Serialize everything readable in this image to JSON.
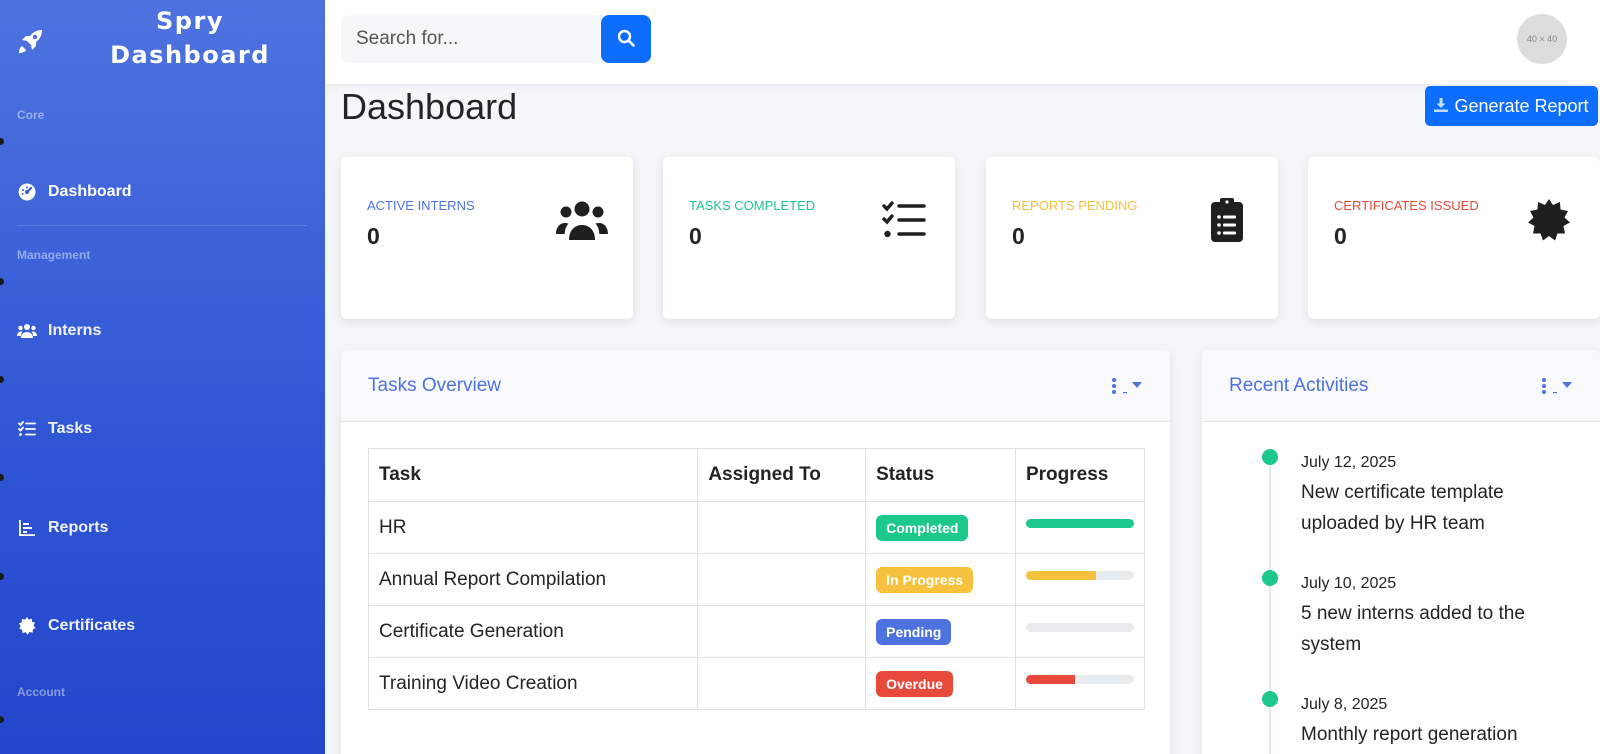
{
  "brand": {
    "line1": "Spry",
    "line2": "Dashboard"
  },
  "sidebar": {
    "sections": {
      "core": "Core",
      "management": "Management",
      "account": "Account"
    },
    "items": [
      {
        "label": "Dashboard",
        "icon": "tachometer-icon",
        "active": true
      },
      {
        "label": "Interns",
        "icon": "users-icon"
      },
      {
        "label": "Tasks",
        "icon": "tasks-icon"
      },
      {
        "label": "Reports",
        "icon": "chart-bar-icon"
      },
      {
        "label": "Certificates",
        "icon": "certificate-icon"
      }
    ]
  },
  "topbar": {
    "search_placeholder": "Search for...",
    "avatar_text": "40 × 40"
  },
  "page": {
    "title": "Dashboard",
    "generate_label": "Generate Report"
  },
  "stats": [
    {
      "label": "Active Interns",
      "value": "0",
      "color": "#4e73df",
      "icon": "users-icon"
    },
    {
      "label": "Tasks Completed",
      "value": "0",
      "color": "#1cc88a",
      "icon": "tasks-icon"
    },
    {
      "label": "Reports Pending",
      "value": "0",
      "color": "#f6c23e",
      "icon": "clipboard-list-icon"
    },
    {
      "label": "Certificates Issued",
      "value": "0",
      "color": "#e74a3b",
      "icon": "certificate-icon"
    }
  ],
  "tasks_panel": {
    "title": "Tasks Overview",
    "columns": [
      "Task",
      "Assigned To",
      "Status",
      "Progress"
    ],
    "rows": [
      {
        "task": "HR",
        "assigned": "",
        "status": "Completed",
        "status_color": "#1cc88a",
        "progress": 100,
        "bar_color": "#1cc88a"
      },
      {
        "task": "Annual Report Compilation",
        "assigned": "",
        "status": "In Progress",
        "status_color": "#f6c23e",
        "progress": 65,
        "bar_color": "#f6c23e"
      },
      {
        "task": "Certificate Generation",
        "assigned": "",
        "status": "Pending",
        "status_color": "#4e73df",
        "progress": 0,
        "bar_color": "#4e73df"
      },
      {
        "task": "Training Video Creation",
        "assigned": "",
        "status": "Overdue",
        "status_color": "#e74a3b",
        "progress": 45,
        "bar_color": "#e74a3b"
      }
    ]
  },
  "activities_panel": {
    "title": "Recent Activities",
    "items": [
      {
        "date": "July 12, 2025",
        "text": "New certificate template uploaded by HR team"
      },
      {
        "date": "July 10, 2025",
        "text": "5 new interns added to the system"
      },
      {
        "date": "July 8, 2025",
        "text": "Monthly report generation"
      }
    ]
  }
}
